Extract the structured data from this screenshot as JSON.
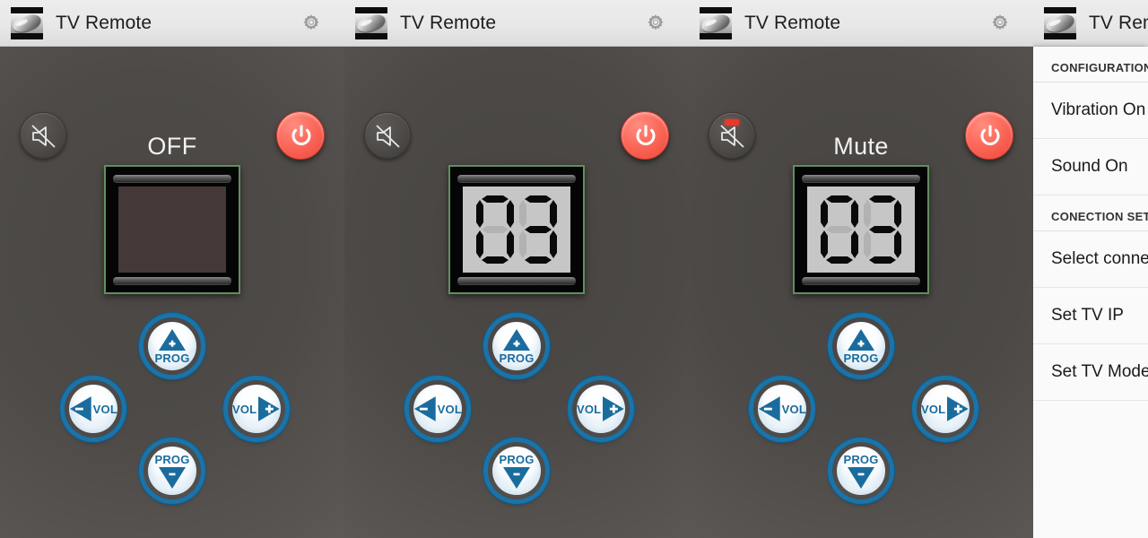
{
  "app": {
    "title": "TV Remote",
    "icon": "tv-remote-icon",
    "settings_icon": "gear-icon"
  },
  "colors": {
    "power_red": "#ef4436",
    "button_blue": "#1b73a8",
    "display_border_green": "#5f8f5f",
    "lcd_background": "#c6c6c6",
    "led_red": "#e23b2d",
    "body_dark": "#4a4644",
    "titlebar": "#ececec"
  },
  "controls": {
    "mute_label": "mute-button",
    "power_label": "power-button",
    "prog_up": {
      "text": "PROG",
      "sign": "+"
    },
    "prog_down": {
      "text": "PROG",
      "sign": "−"
    },
    "vol_down": {
      "text": "VOL",
      "sign": "−"
    },
    "vol_up": {
      "text": "VOL",
      "sign": "+"
    }
  },
  "panels": [
    {
      "id": "panel-off",
      "status_text": "OFF",
      "display_mode": "off",
      "digits": [],
      "mute_active": false
    },
    {
      "id": "panel-channel",
      "status_text": "",
      "display_mode": "lcd",
      "digits": [
        "0",
        "3"
      ],
      "channel": "03",
      "mute_active": false
    },
    {
      "id": "panel-mute",
      "status_text": "Mute",
      "display_mode": "lcd",
      "digits": [
        "0",
        "3"
      ],
      "channel": "03",
      "mute_active": true
    }
  ],
  "settings": {
    "sections": [
      {
        "header": "CONFIGURATION",
        "items": [
          "Vibration On",
          "Sound On"
        ]
      },
      {
        "header": "CONECTION SETTINGS",
        "items": [
          "Select connection",
          "Set TV IP",
          "Set TV Model"
        ]
      }
    ]
  },
  "segment_map": {
    "0": [
      "a",
      "b",
      "c",
      "d",
      "e",
      "f"
    ],
    "3": [
      "a",
      "b",
      "c",
      "d",
      "g"
    ]
  }
}
